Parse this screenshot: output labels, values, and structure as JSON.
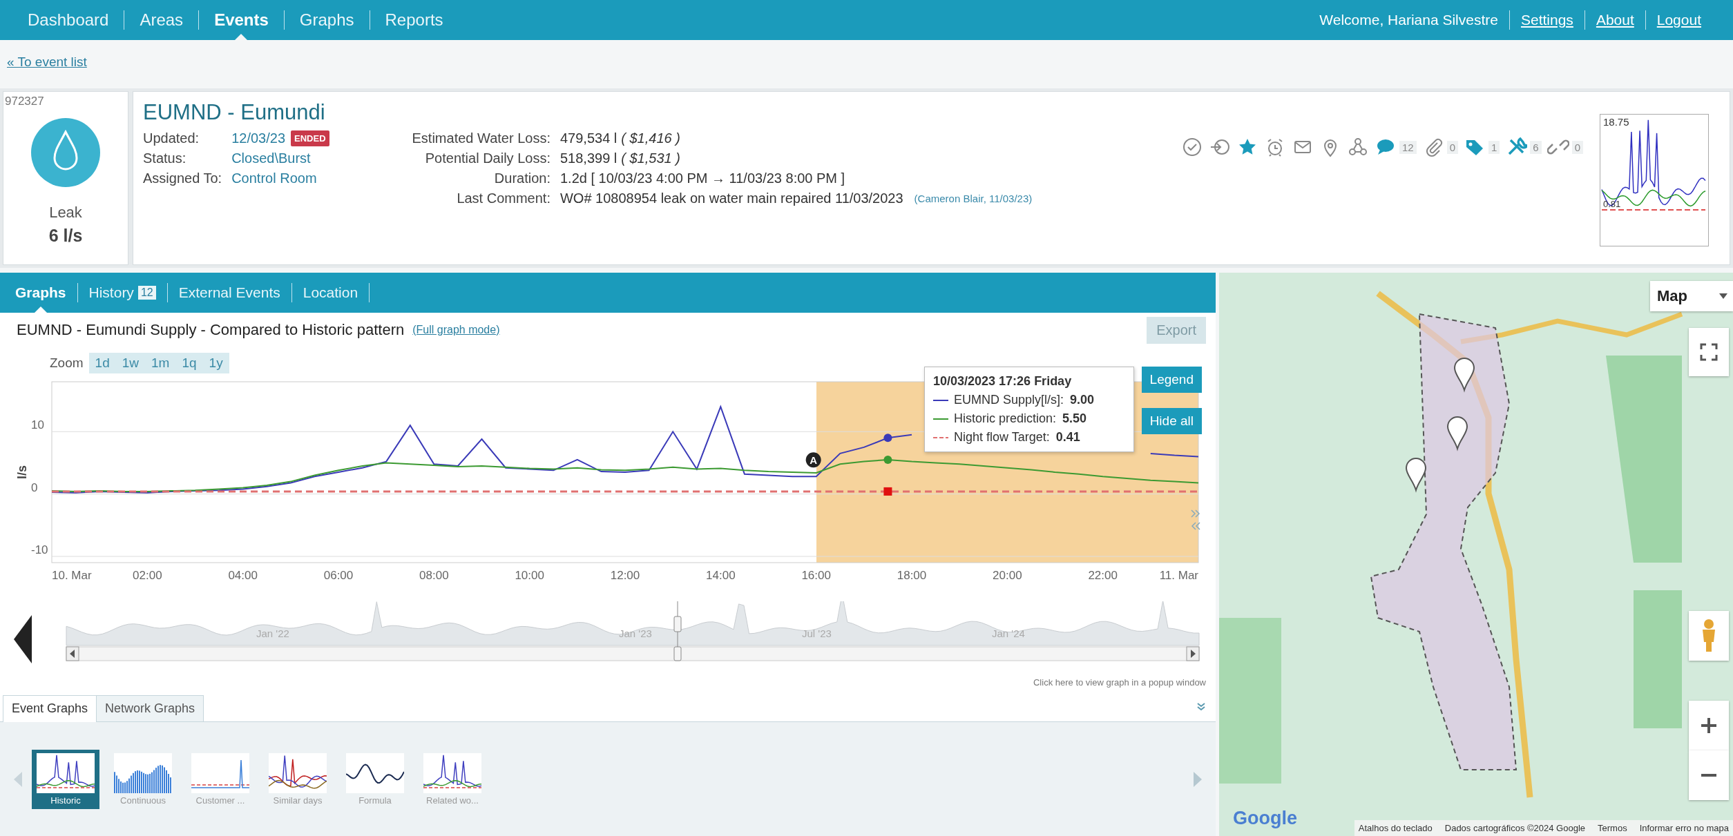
{
  "nav": {
    "items": [
      {
        "label": "Dashboard",
        "selected": false
      },
      {
        "label": "Areas",
        "selected": false
      },
      {
        "label": "Events",
        "selected": true
      },
      {
        "label": "Graphs",
        "selected": false
      },
      {
        "label": "Reports",
        "selected": false
      }
    ],
    "welcome": "Welcome, Hariana Silvestre",
    "links": [
      "Settings",
      "About",
      "Logout"
    ]
  },
  "back_link": "« To event list",
  "event": {
    "id": "972327",
    "type": "Leak",
    "rate": "6 l/s",
    "title": "EUMND - Eumundi",
    "fields": [
      {
        "label": "Updated:",
        "value": "12/03/23",
        "badge": "ENDED"
      },
      {
        "label": "Status:",
        "value": "Closed\\Burst"
      },
      {
        "label": "Assigned To:",
        "value": "Control Room"
      }
    ],
    "stats": [
      {
        "label": "Estimated Water Loss:",
        "value": "479,534 l",
        "extra": "( $1,416 )"
      },
      {
        "label": "Potential Daily Loss:",
        "value": "518,399 l",
        "extra": "( $1,531 )"
      },
      {
        "label": "Duration:",
        "value": "1.2d [ 10/03/23 4:00 PM → 11/03/23 8:00 PM ]"
      },
      {
        "label": "Last Comment:",
        "value": "WO# 10808954 leak on water main repaired 11/03/2023",
        "note": "(Cameron Blair, 11/03/23)"
      }
    ],
    "actions": [
      {
        "kind": "check",
        "highlighted": false
      },
      {
        "kind": "signin",
        "highlighted": false
      },
      {
        "kind": "star",
        "highlighted": true
      },
      {
        "kind": "alarm",
        "highlighted": false
      },
      {
        "kind": "mail",
        "highlighted": false
      },
      {
        "kind": "pin",
        "highlighted": false
      },
      {
        "kind": "network",
        "highlighted": false
      },
      {
        "kind": "comment",
        "highlighted": true,
        "count": "12"
      },
      {
        "kind": "clip",
        "highlighted": false,
        "count": "0"
      },
      {
        "kind": "tag",
        "highlighted": true,
        "count": "1"
      },
      {
        "kind": "tools",
        "highlighted": true,
        "count": "6"
      },
      {
        "kind": "link",
        "highlighted": false,
        "count": "0"
      }
    ],
    "thumbnail": {
      "max": "18.75",
      "min": "0.81"
    }
  },
  "tabs": [
    {
      "label": "Graphs",
      "selected": true
    },
    {
      "label": "History",
      "count": "12",
      "selected": false
    },
    {
      "label": "External Events",
      "selected": false
    },
    {
      "label": "Location",
      "selected": false
    }
  ],
  "graph": {
    "title": "EUMND - Eumundi Supply - Compared to Historic pattern",
    "mode_link": "(Full graph mode)",
    "export": "Export",
    "zoom_label": "Zoom",
    "zoom_options": [
      "1d",
      "1w",
      "1m",
      "1q",
      "1y"
    ],
    "legend_button": "Legend",
    "hide_button": "Hide all",
    "chart_data": {
      "type": "line",
      "ylabel": "l/s",
      "x": [
        0,
        0.5,
        1,
        1.5,
        2,
        2.5,
        3,
        3.5,
        4,
        4.5,
        5,
        5.5,
        6,
        6.5,
        7,
        7.5,
        8,
        8.5,
        9,
        9.5,
        10,
        10.5,
        11,
        11.5,
        12,
        12.5,
        13,
        13.5,
        14,
        14.5,
        15,
        15.5,
        16,
        16.5,
        17,
        17.5,
        18,
        18.5,
        19,
        19.5,
        20,
        20.5,
        21,
        21.5,
        22,
        22.5,
        23,
        23.5,
        24
      ],
      "xlim": [
        0,
        24
      ],
      "ylim": [
        -11,
        18
      ],
      "xticks": [
        {
          "value": 0,
          "label": "10. Mar"
        },
        {
          "value": 2,
          "label": "02:00"
        },
        {
          "value": 4,
          "label": "04:00"
        },
        {
          "value": 6,
          "label": "06:00"
        },
        {
          "value": 8,
          "label": "08:00"
        },
        {
          "value": 10,
          "label": "10:00"
        },
        {
          "value": 12,
          "label": "12:00"
        },
        {
          "value": 14,
          "label": "14:00"
        },
        {
          "value": 16,
          "label": "16:00"
        },
        {
          "value": 18,
          "label": "18:00"
        },
        {
          "value": 20,
          "label": "20:00"
        },
        {
          "value": 22,
          "label": "22:00"
        },
        {
          "value": 24,
          "label": "11. Mar"
        }
      ],
      "yticks": [
        -10,
        0,
        10
      ],
      "series": [
        {
          "name": "EUMND Supply[l/s]:",
          "color": "#3a3ab8",
          "values": [
            0.3,
            0.2,
            0.4,
            0.3,
            0.2,
            0.4,
            0.5,
            0.6,
            0.8,
            1.2,
            1.8,
            2.8,
            3.5,
            4.2,
            5.2,
            11,
            4.8,
            4.5,
            8.8,
            4.2,
            4.0,
            3.8,
            5.5,
            3.6,
            3.5,
            3.8,
            10,
            4,
            14,
            3.2,
            3.0,
            2.8,
            2.8,
            6.5,
            7.5,
            9.0,
            9.5,
            null,
            null,
            null,
            null,
            null,
            null,
            null,
            null,
            null,
            6.5,
            6.2,
            6.0
          ]
        },
        {
          "name": "Historic prediction:",
          "color": "#3c9a32",
          "values": [
            0.5,
            0.4,
            0.5,
            0.4,
            0.4,
            0.5,
            0.6,
            0.8,
            1.0,
            1.4,
            2.0,
            3.0,
            3.8,
            4.5,
            5.0,
            4.8,
            4.6,
            4.4,
            4.5,
            4.3,
            4.1,
            4.0,
            4.2,
            3.9,
            3.8,
            4.0,
            4.3,
            4.0,
            4.1,
            3.8,
            3.6,
            3.5,
            3.4,
            4.8,
            5.2,
            5.5,
            5.2,
            5.0,
            4.8,
            4.5,
            4.2,
            3.9,
            3.5,
            3.2,
            2.8,
            2.5,
            2.2,
            2.0,
            1.8
          ]
        },
        {
          "name": "Night flow Target:",
          "color": "#e07070",
          "line_style": "dashed",
          "values": [
            0.41,
            0.41,
            0.41,
            0.41,
            0.41,
            0.41,
            0.41,
            0.41,
            0.41,
            0.41,
            0.41,
            0.41,
            0.41,
            0.41,
            0.41,
            0.41,
            0.41,
            0.41,
            0.41,
            0.41,
            0.41,
            0.41,
            0.41,
            0.41,
            0.41,
            0.41,
            0.41,
            0.41,
            0.41,
            0.41,
            0.41,
            0.41,
            0.41,
            0.41,
            0.41,
            0.41,
            0.41,
            0.41,
            0.41,
            0.41,
            0.41,
            0.41,
            0.41,
            0.41,
            0.41,
            0.41,
            0.41,
            0.41,
            0.41
          ]
        }
      ],
      "grid": true,
      "annotations": [
        {
          "x": 16,
          "y": 2.8,
          "text": "A"
        }
      ]
    },
    "tooltip": {
      "title": "10/03/2023 17:26 Friday",
      "values": [
        "9.00",
        "5.50",
        "0.41"
      ]
    }
  },
  "navigator": {
    "labels": [
      "Jan '22",
      "Jan '23",
      "Jul '23",
      "Jan '24"
    ],
    "popup_hint": "Click here to view graph in a popup window"
  },
  "bottom_tabs": [
    {
      "label": "Event Graphs",
      "selected": true
    },
    {
      "label": "Network Graphs",
      "selected": false
    }
  ],
  "thumbnails": [
    {
      "label": "Historic",
      "kind": "historic",
      "selected": true
    },
    {
      "label": "Continuous",
      "kind": "bars",
      "selected": false
    },
    {
      "label": "Customer ...",
      "kind": "flat",
      "selected": false
    },
    {
      "label": "Similar days",
      "kind": "similar",
      "selected": false
    },
    {
      "label": "Formula",
      "kind": "formula",
      "selected": false
    },
    {
      "label": "Related wo...",
      "kind": "historic",
      "selected": false
    }
  ],
  "map": {
    "type_control": "Map",
    "logo": "Google",
    "attribution": [
      "Atalhos do teclado",
      "Dados cartográficos ©2024 Google",
      "Termos",
      "Informar erro no mapa"
    ]
  }
}
